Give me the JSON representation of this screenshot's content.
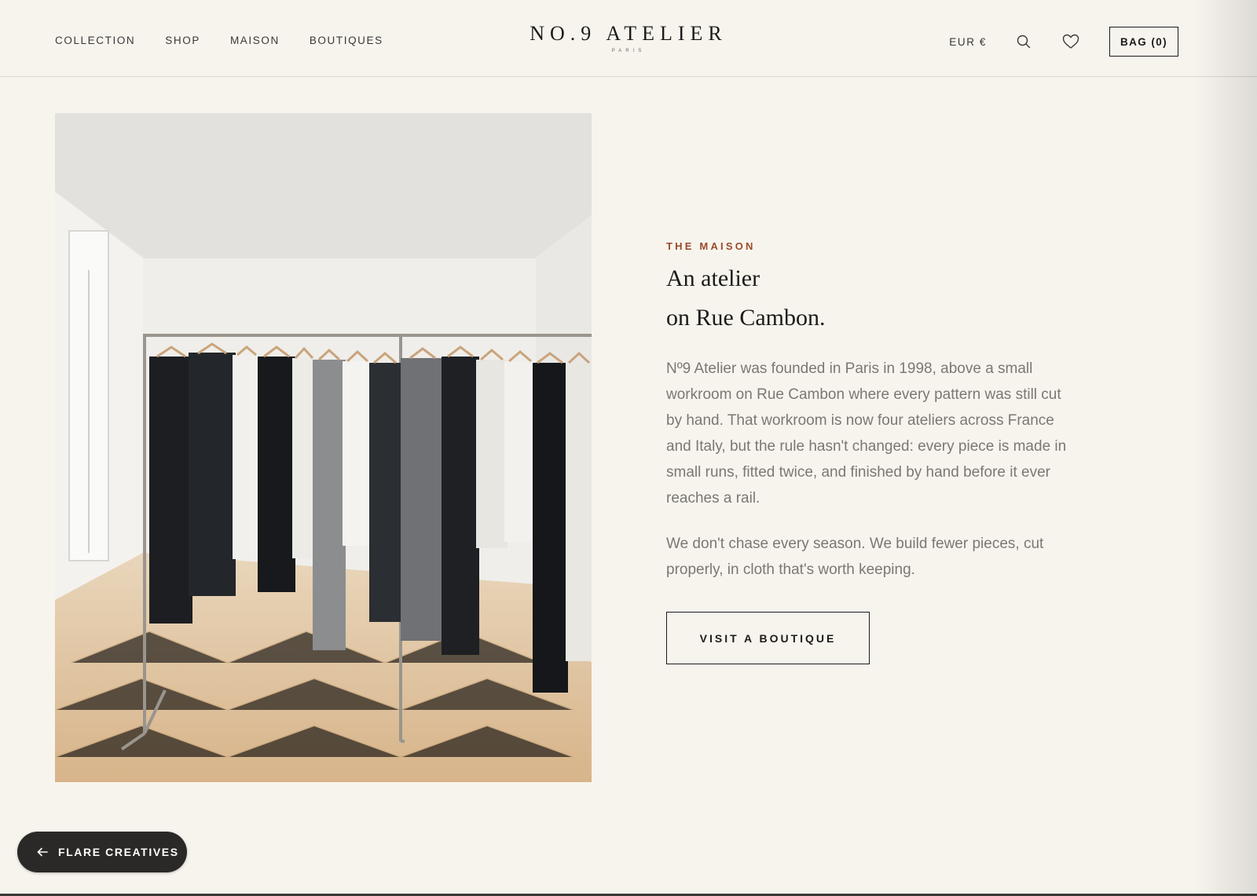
{
  "header": {
    "nav": [
      "COLLECTION",
      "SHOP",
      "MAISON",
      "BOUTIQUES"
    ],
    "logo_name": "NO.9 ATELIER",
    "logo_city": "PARIS",
    "currency": "EUR €",
    "search_icon": "search-icon",
    "wishlist_icon": "heart-icon",
    "bag_label": "BAG (0)"
  },
  "main": {
    "image_alt": "clothing-rack-photo",
    "eyebrow": "THE MAISON",
    "headline_line1": "An atelier",
    "headline_line2": "on Rue Cambon.",
    "paragraph1": "Nº9 Atelier was founded in Paris in 1998, above a small workroom on Rue Cambon where every pattern was still cut by hand. That workroom is now four ateliers across France and Italy, but the rule hasn't changed: every piece is made in small runs, fitted twice, and finished by hand before it ever reaches a rail.",
    "paragraph2": "We don't chase every season. We build fewer pieces, cut properly, in cloth that's worth keeping.",
    "cta_label": "VISIT A BOUTIQUE"
  },
  "floating_badge": {
    "icon": "arrow-left-icon",
    "label": "FLARE CREATIVES"
  },
  "colors": {
    "background": "#f7f4ee",
    "accent": "#9b4a2a",
    "text": "#1d1b19",
    "body_text": "#7b7772",
    "pill": "#2b2927"
  }
}
